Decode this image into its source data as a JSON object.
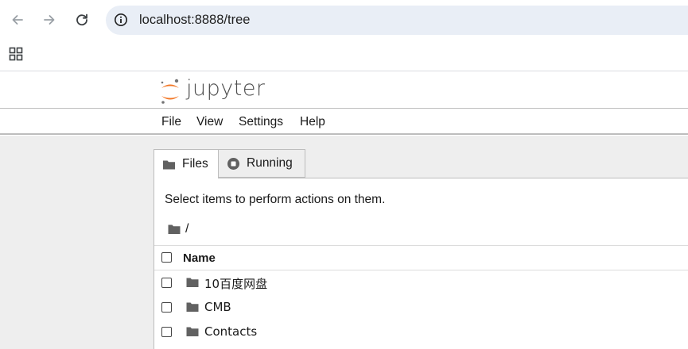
{
  "browser": {
    "url": "localhost:8888/tree"
  },
  "header": {
    "logo_text": "jupyter"
  },
  "menubar": {
    "items": [
      "File",
      "View",
      "Settings",
      "Help"
    ]
  },
  "tabs": [
    {
      "label": "Files",
      "icon": "folder-icon",
      "active": true
    },
    {
      "label": "Running",
      "icon": "stop-circle-icon",
      "active": false
    }
  ],
  "filebrowser": {
    "hint": "Select items to perform actions on them.",
    "breadcrumb": "/",
    "column_name": "Name",
    "items": [
      {
        "name": "10百度网盘",
        "type": "folder"
      },
      {
        "name": "CMB",
        "type": "folder"
      },
      {
        "name": "Contacts",
        "type": "folder"
      }
    ]
  },
  "colors": {
    "logo_orange": "#f37726",
    "address_bg": "#e9eef6",
    "main_bg": "#eeeeee"
  }
}
